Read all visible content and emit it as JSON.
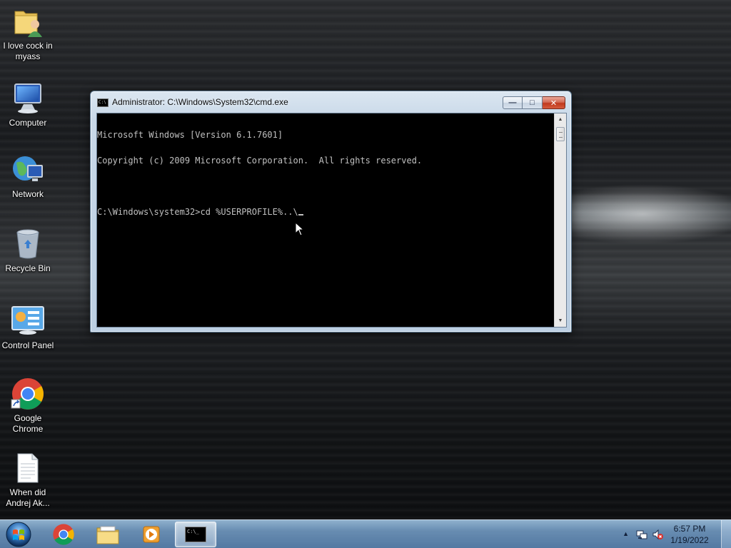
{
  "desktop": {
    "icons": [
      {
        "name": "folder-user-icon",
        "label": "I love cock in myass"
      },
      {
        "name": "computer-icon",
        "label": "Computer"
      },
      {
        "name": "network-icon",
        "label": "Network"
      },
      {
        "name": "recycle-bin-icon",
        "label": "Recycle Bin"
      },
      {
        "name": "control-panel-icon",
        "label": "Control Panel"
      },
      {
        "name": "chrome-icon",
        "label": "Google Chrome"
      },
      {
        "name": "text-document-icon",
        "label": "When did Andrej Ak..."
      }
    ]
  },
  "cmd_window": {
    "title": "Administrator: C:\\Windows\\System32\\cmd.exe",
    "icon_text": "C:\\",
    "lines": [
      "Microsoft Windows [Version 6.1.7601]",
      "Copyright (c) 2009 Microsoft Corporation.  All rights reserved.",
      "",
      "C:\\Windows\\system32>cd %USERPROFILE%..\\"
    ],
    "buttons": {
      "minimize": "—",
      "maximize": "□",
      "close": "✕"
    }
  },
  "taskbar": {
    "pinned": [
      "start-orb",
      "chrome-icon",
      "file-explorer-icon",
      "media-player-icon",
      "cmd-icon"
    ],
    "active": "cmd-icon",
    "cmd_icon_text": "C:\\_",
    "tray": {
      "arrow": "▲",
      "icons": [
        "network-tray-icon",
        "volume-muted-icon"
      ]
    },
    "clock": {
      "time": "6:57 PM",
      "date": "1/19/2022"
    }
  }
}
